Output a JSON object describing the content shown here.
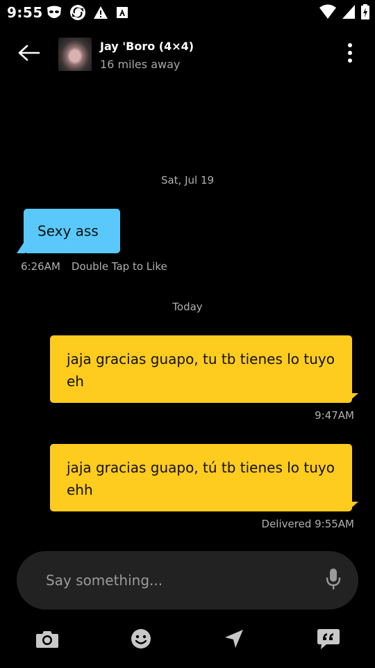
{
  "status_bar": {
    "time": "9:55",
    "left_icons": [
      "grindr-mask-icon",
      "sync-app-icon",
      "warning-icon",
      "a-font-icon"
    ],
    "right_icons": [
      "wifi-icon",
      "cell-signal-icon",
      "battery-icon"
    ]
  },
  "header": {
    "back_icon": "arrow-left-icon",
    "contact_name": "Jay 'Boro (4×4)",
    "contact_distance": "16 miles away",
    "menu_icon": "more-vertical-icon"
  },
  "conversation": {
    "separators": [
      {
        "label": "Sat, Jul 19"
      },
      {
        "label": "Today"
      }
    ],
    "messages": [
      {
        "direction": "incoming",
        "text": "Sexy ass",
        "time": "6:26AM",
        "action": "Double Tap to Like"
      },
      {
        "direction": "outgoing",
        "text": "jaja gracias guapo, tu tb tienes lo tuyo eh",
        "meta": "9:47AM"
      },
      {
        "direction": "outgoing",
        "text": "jaja gracias guapo, tú tb tienes lo tuyo ehh",
        "meta": "Delivered 9:55AM"
      }
    ]
  },
  "composer": {
    "placeholder": "Say something...",
    "mic_icon": "microphone-icon"
  },
  "toolbar": {
    "items": [
      {
        "icon": "camera-icon"
      },
      {
        "icon": "emoji-icon"
      },
      {
        "icon": "location-arrow-icon"
      },
      {
        "icon": "saved-phrases-icon"
      }
    ]
  },
  "colors": {
    "background": "#000000",
    "incoming_bubble": "#5ac8fa",
    "outgoing_bubble": "#fecb1f",
    "composer_bg": "#222222",
    "muted_text": "#b0b0b0"
  }
}
